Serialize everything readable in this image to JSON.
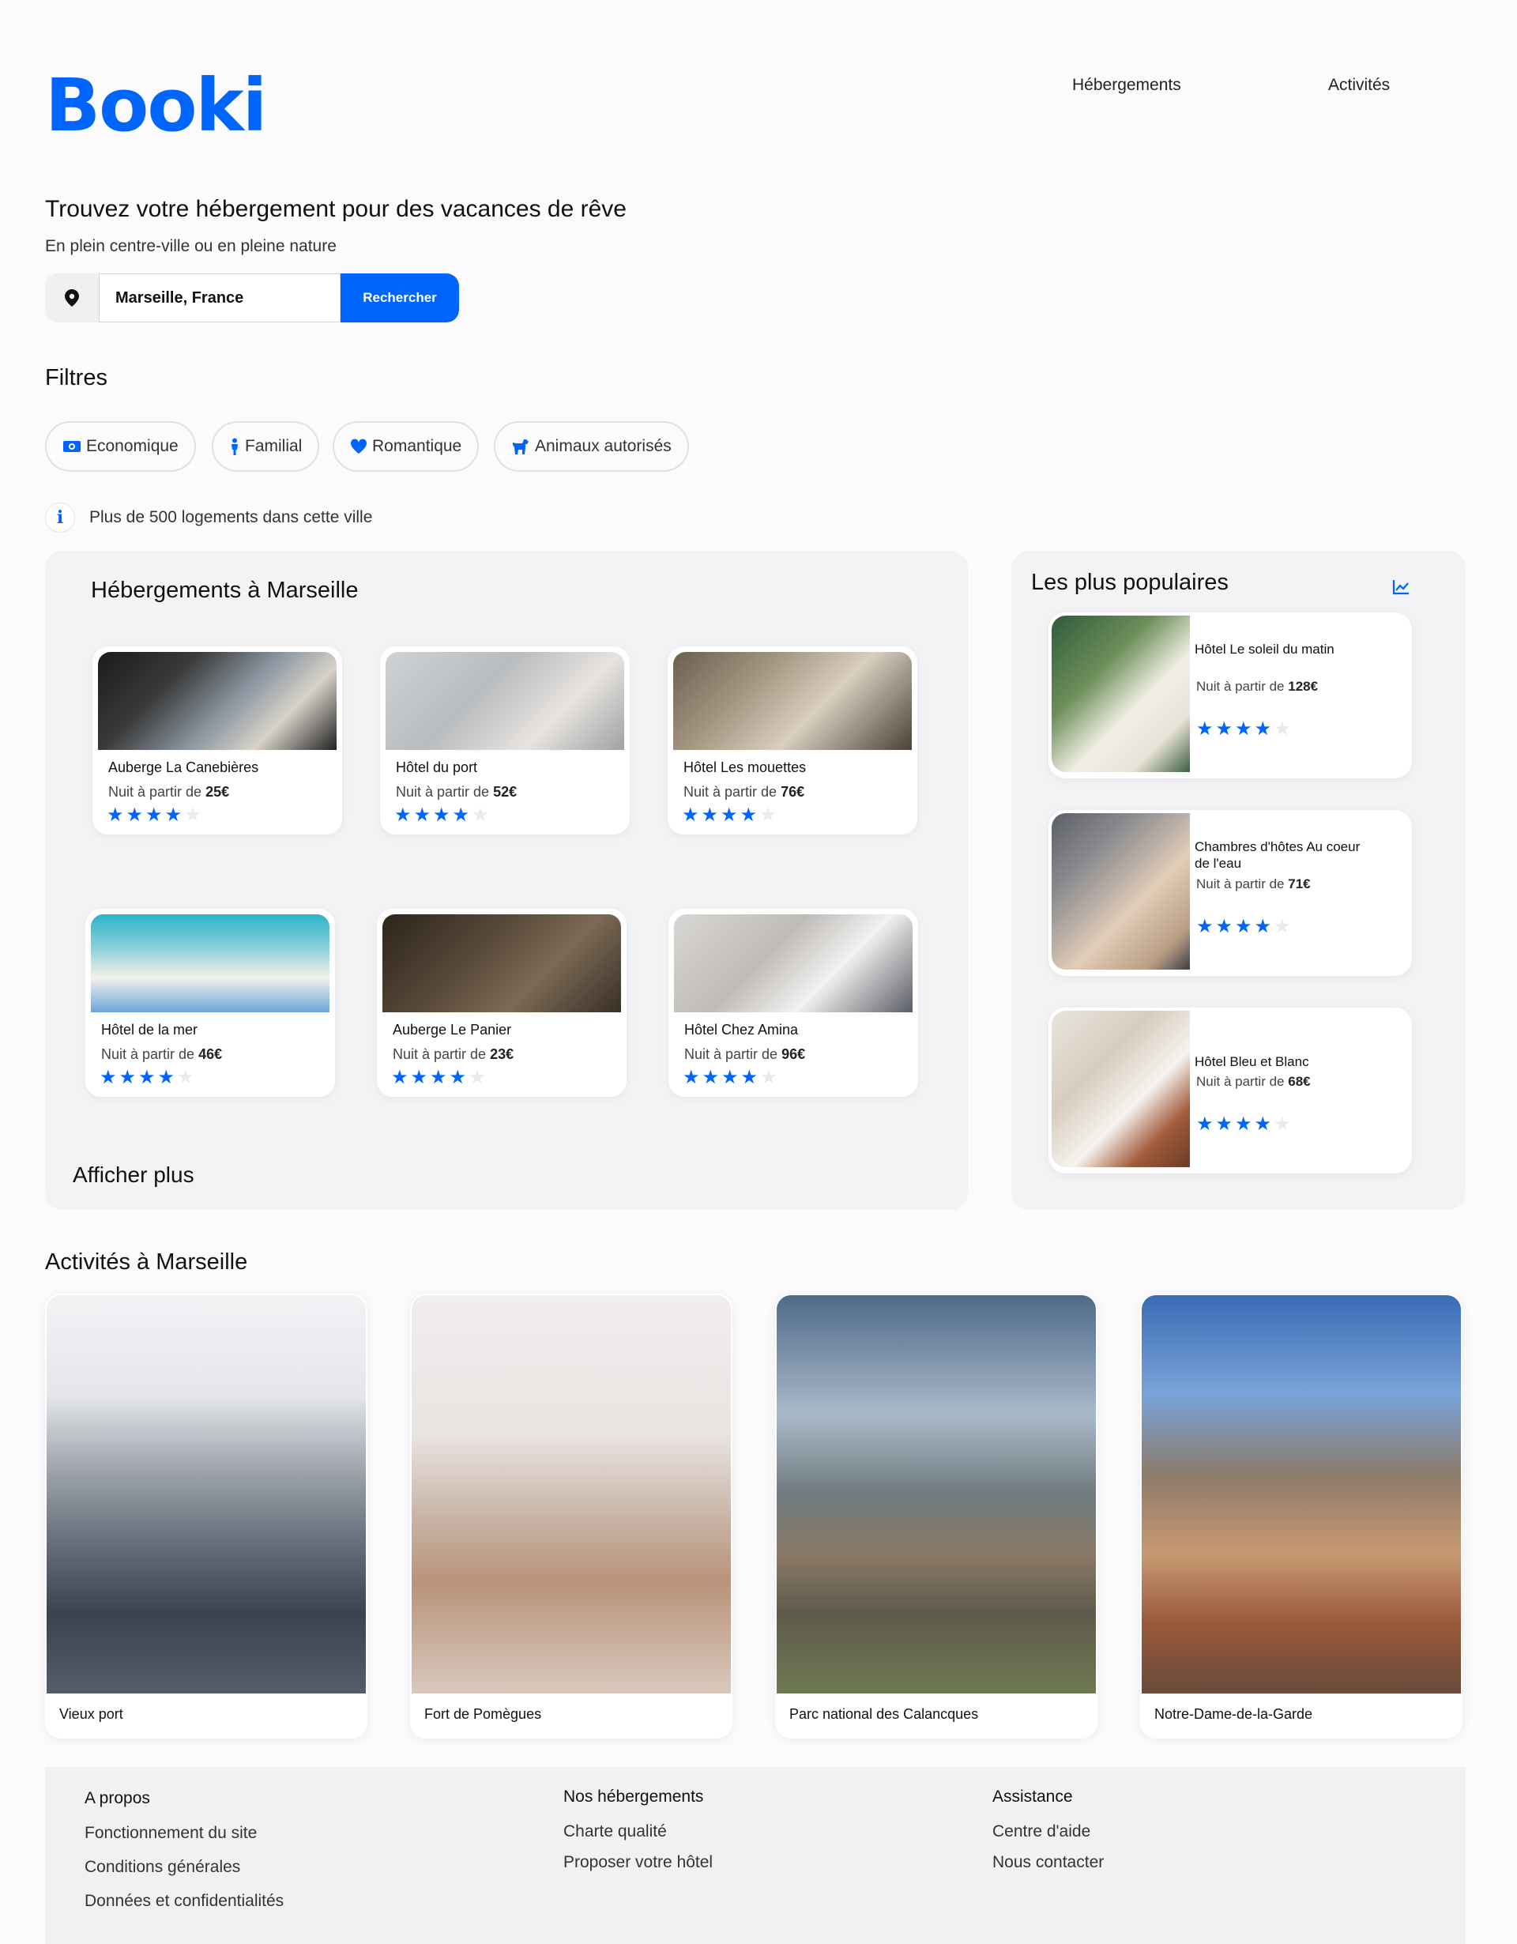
{
  "header": {
    "logo": "Booki",
    "nav": [
      "Hébergements",
      "Activités"
    ]
  },
  "hero": {
    "title": "Trouvez votre hébergement pour des vacances de rêve",
    "subtitle": "En plein centre-ville ou en pleine nature"
  },
  "search": {
    "value": "Marseille, France",
    "button_label": "Rechercher"
  },
  "filters": {
    "title": "Filtres",
    "chips": [
      {
        "label": "Economique",
        "icon": "money-icon"
      },
      {
        "label": "Familial",
        "icon": "person-icon"
      },
      {
        "label": "Romantique",
        "icon": "heart-icon"
      },
      {
        "label": "Animaux autorisés",
        "icon": "dog-icon"
      }
    ]
  },
  "info": {
    "text": "Plus de 500 logements dans cette ville"
  },
  "accommodations": {
    "title": "Hébergements à Marseille",
    "more": "Afficher plus",
    "items": [
      {
        "name": "Auberge La Canebières",
        "price_prefix": "Nuit à partir de ",
        "price": "25€",
        "rating": 4
      },
      {
        "name": "Hôtel du port",
        "price_prefix": "Nuit à partir de ",
        "price": "52€",
        "rating": 4
      },
      {
        "name": "Hôtel Les mouettes",
        "price_prefix": "Nuit à partir de ",
        "price": "76€",
        "rating": 4
      },
      {
        "name": "Hôtel de la mer",
        "price_prefix": "Nuit à partir de ",
        "price": "46€",
        "rating": 4
      },
      {
        "name": "Auberge Le Panier",
        "price_prefix": "Nuit à partir de ",
        "price": "23€",
        "rating": 4
      },
      {
        "name": "Hôtel Chez Amina",
        "price_prefix": "Nuit à partir de ",
        "price": "96€",
        "rating": 4
      }
    ]
  },
  "popular": {
    "title": "Les plus populaires",
    "items": [
      {
        "name": "Hôtel Le soleil du matin",
        "price_prefix": "Nuit à partir de ",
        "price": "128€",
        "rating": 4
      },
      {
        "name": "Chambres d'hôtes Au coeur de l'eau",
        "price_prefix": "Nuit à partir de ",
        "price": "71€",
        "rating": 4
      },
      {
        "name": "Hôtel Bleu et Blanc",
        "price_prefix": "Nuit à partir de ",
        "price": "68€",
        "rating": 4
      }
    ]
  },
  "activities": {
    "title": "Activités à Marseille",
    "items": [
      "Vieux port",
      "Fort de Pomègues",
      "Parc national des Calancques",
      "Notre-Dame-de-la-Garde"
    ]
  },
  "footer": {
    "columns": [
      {
        "title": "A propos",
        "links": [
          "Fonctionnement du site",
          "Conditions générales",
          "Données et confidentialités"
        ]
      },
      {
        "title": "Nos hébergements",
        "links": [
          "Charte qualité",
          "Proposer votre hôtel"
        ]
      },
      {
        "title": "Assistance",
        "links": [
          "Centre d'aide",
          "Nous contacter"
        ]
      }
    ]
  },
  "colors": {
    "brand": "#0065fc",
    "panel": "#f3f3f6",
    "star_off": "#e9e9ef"
  }
}
